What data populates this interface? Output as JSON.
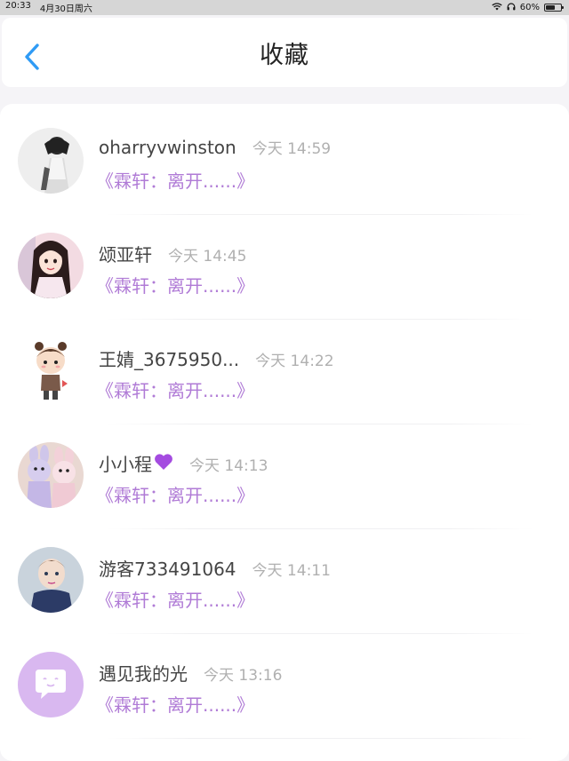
{
  "status_bar": {
    "time": "20:33",
    "date": "4月30日周六",
    "battery": "60%",
    "battery_level": 0.6
  },
  "header": {
    "title": "收藏",
    "back_icon": "chevron-left-icon",
    "accent_color": "#2f9bf5"
  },
  "colors": {
    "quote": "#b07bd6",
    "time": "#b0b0b0",
    "name": "#444444"
  },
  "items": [
    {
      "name": "oharryvwinston",
      "time": "今天 14:59",
      "quote": "《霖轩：离开......》",
      "avatar": "avatar-bw-girl"
    },
    {
      "name": "颂亚轩",
      "time": "今天 14:45",
      "quote": "《霖轩：离开......》",
      "avatar": "avatar-girl-photo"
    },
    {
      "name": "王婧_3675950...",
      "time": "今天 14:22",
      "quote": "《霖轩：离开......》",
      "avatar": "avatar-cartoon-boy"
    },
    {
      "name": "小小程",
      "time": "今天 14:13",
      "quote": "《霖轩：离开......》",
      "avatar": "avatar-plush-toys",
      "emoji": "purple-heart-icon"
    },
    {
      "name": "游客733491064",
      "time": "今天 14:11",
      "quote": "《霖轩：离开......》",
      "avatar": "avatar-child-photo"
    },
    {
      "name": "遇见我的光",
      "time": "今天 13:16",
      "quote": "《霖轩：离开......》",
      "avatar": "avatar-default-chat"
    }
  ]
}
